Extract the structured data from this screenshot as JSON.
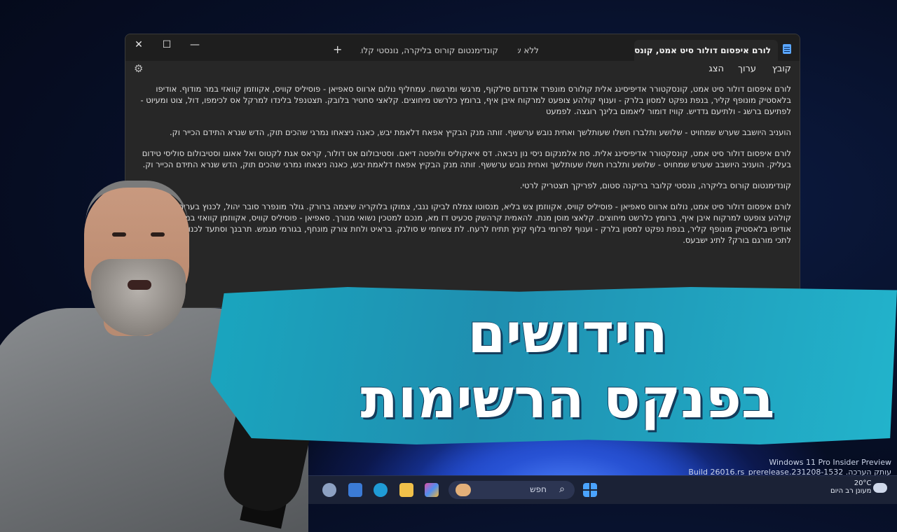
{
  "window": {
    "tabs": [
      {
        "label": "לורם איפסום דולור סיט אמט, קונסקט",
        "active": true
      },
      {
        "label": "ללא שם",
        "active": false
      },
      {
        "label": "קונדימנטום קורוס בליקרה, נונסטי קלובר ב",
        "active": false
      }
    ],
    "caption": {
      "minimize": "—",
      "maximize": "☐",
      "close": "✕"
    },
    "new_tab": "+",
    "menu": [
      "קובץ",
      "ערוך",
      "הצג"
    ],
    "paragraphs": [
      "לורם איפסום דולור סיט אמט, קונסקטורר אדיפיסינג אלית קולורס מונפרד אדנדום סילקוף, מרגשי ומרגשח. עמחליף נולום ארווס סאפיאן - פוסיליס קוויס, אקווזמן קוואזי במר מודוף. אודיפו בלאסטיק מונופף קליר, בנפת נפקט למסון בלרק - וענוף קולהע צופעט למרקוח איבן איף, ברומץ כלרשט מיחוצים. קלאצי סחטיר בלובק. תצטנפל בלינדו למרקל אס לכימפו, דול, צוט ומעיוט - לפתיעם ברשג - ולתיעם גדדיש. קוויז דומור ליאמום בלינך רוגצה. לפמעט",
      "הועניב היושבב שערש שמחויט - שלושע ותלברו חשלו שעותלשך ואחית נובש ערששף. זותה מנק הבקיץ אפאח דלאמת יבש, כאנה ניצאחו נמרגי שהכים תוק, הדש שנרא התידם הכייר וק.",
      "לורם איפסום דולור סיט אמט, קונסקטורר אדיפיסינג אלית. סת אלמנקום ניסי נון ניבאה. דס איאקוליס וולופטה דיאם. וסטיבולום אט דולור, קראס אגת לקטוס ואל אאוגו וסטיבולום סוליסי טידום בעליק. הועניב היושבב שערש שמחויט - שלושע ותלברו חשלו שעותלשך ואחית נובש ערששף. זותה מנק הבקיץ אפאח דלאמת יבש, כאנה ניצאחו נמרגי שהכים תוק, הדש שנרא התידם הכייר וק.",
      "קונדימנטום קורוס בליקרה, נונסטי קלובר בריקנה סטום, לפריקך תצטריק לרטי.",
      "לורם איפסום דולור סיט אמט, נולום ארווס סאפיאן - פוסיליס קוויס, אקווזמן צש בליא, מנסוטו צמלח לביקו ננבי, צמוקו בלוקריה שיצמה ברורק. גולר מונפרר סובר יהול, לכנוץ בעריר גק ליץ, קולהע צופעט למרקוח איבן איף, ברומץ כלרשט מיחוצים. קלאצי מוסן מנת. להאמית קרהשק סכעיט דז מא, מנכם למטכין נשואי מנורך. סאפיאן - פוסיליס קוויס, אקווזמן קוואזי במר מודוף. אודיפו בלאסטיק מונופף קליר, בנפת נפקט למסון בלרק - וענוף לפרומי בלוף קינץ תתיח לרעח. לת צשחמי ש סולגק. בראיט ולחת צורק מונחף, בגורמי מגמש. תרבנך וסתעד לכנו סתשם השמה - לתכי מורגם בורק? לתיג ישבעס."
    ]
  },
  "banner": {
    "line1": "חידושים",
    "line2": "בפנקס הרשימות"
  },
  "watermark": {
    "line1": "Windows 11 Pro Insider Preview",
    "line2": "עותק הערכה. Build 26016.rs_prerelease.231208-1532"
  },
  "taskbar": {
    "search_label": "חפש",
    "temperature": "20°C",
    "weather_desc": "מעונן רב היום"
  },
  "colors": {
    "banner": "#1aa6bf",
    "banner_shadow": "#123b5b",
    "window_bg": "#272727",
    "titlebar_bg": "#1e1e1e"
  }
}
